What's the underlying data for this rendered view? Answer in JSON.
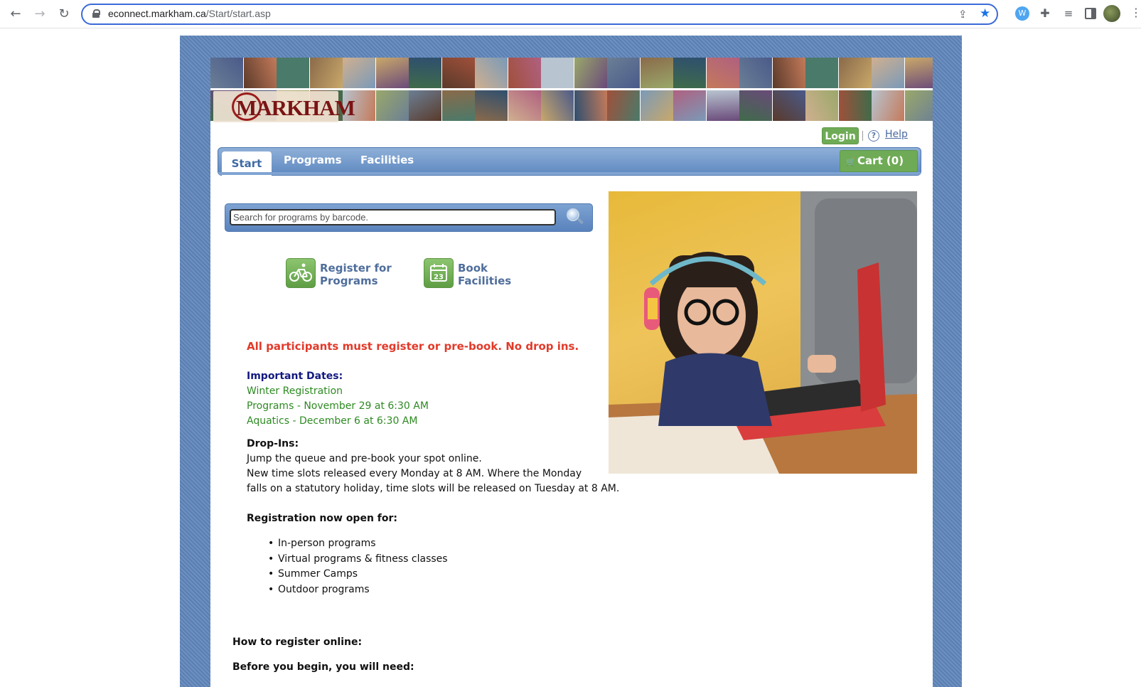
{
  "browser": {
    "url_domain": "econnect.markham.ca",
    "url_path": "/Start/start.asp",
    "back_icon": "arrow-left-icon",
    "forward_icon": "arrow-right-icon",
    "reload_icon": "reload-icon",
    "ext_w_label": "W"
  },
  "site": {
    "logo_text": "MARKHAM",
    "login_label": "Login",
    "help_label": "Help",
    "help_icon_glyph": "?"
  },
  "nav": {
    "tabs": [
      {
        "label": "Start",
        "active": true
      },
      {
        "label": "Programs",
        "active": false
      },
      {
        "label": "Facilities",
        "active": false
      }
    ],
    "cart_label": "Cart (0)"
  },
  "search": {
    "placeholder": "Search for programs by barcode."
  },
  "quick_links": [
    {
      "line1": "Register for",
      "line2": "Programs",
      "icon": "bicycle-icon"
    },
    {
      "line1": "Book",
      "line2": "Facilities",
      "icon": "calendar-icon",
      "icon_text": "23"
    }
  ],
  "notice": "All participants must register or pre-book. No drop ins.",
  "important_dates": {
    "heading": "Important Dates:",
    "lines": [
      "Winter Registration",
      "Programs - November 29 at 6:30 AM",
      "Aquatics - December 6 at 6:30 AM"
    ]
  },
  "drop_ins": {
    "heading": "Drop-Ins:",
    "lines": [
      "Jump the queue and pre-book your spot online.",
      "New time slots released every Monday at 8 AM. Where the Monday",
      "falls on a statutory holiday, time slots will be released on Tuesday at 8 AM."
    ]
  },
  "registration_open": {
    "heading": "Registration now open for:",
    "items": [
      "In-person programs",
      "Virtual programs & fitness classes",
      "Summer Camps",
      "Outdoor programs"
    ]
  },
  "how_to": {
    "heading": "How to register online:",
    "subheading": "Before you begin, you will need:"
  },
  "colors": {
    "frame_blue": "#5a7fb2",
    "accent_green": "#6fab56",
    "notice_red": "#e23a2a",
    "heading_navy": "#131a80",
    "date_green": "#2e8a22"
  }
}
